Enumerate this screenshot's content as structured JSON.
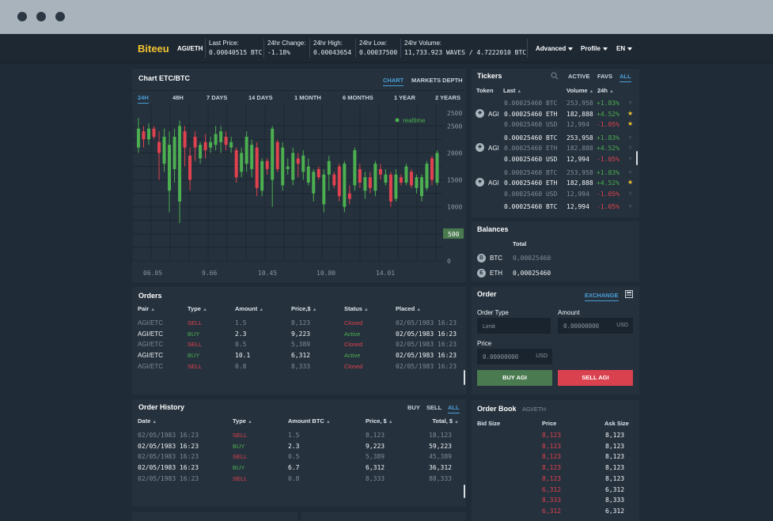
{
  "header": {
    "brand": "Biteeu",
    "pair": "AGI/ETH",
    "stats": [
      {
        "label": "Last Price:",
        "value": "0.00040515 BTC"
      },
      {
        "label": "24hr Change:",
        "value": "-1.18%"
      },
      {
        "label": "24hr High:",
        "value": "0.00043654"
      },
      {
        "label": "24hr Low:",
        "value": "0.00037500"
      },
      {
        "label": "24hr Volume:",
        "value": "11,733.923 WAVES / 4.7222010 BTC"
      }
    ],
    "menus": [
      "Advanced",
      "Profile",
      "EN"
    ]
  },
  "chart_panel": {
    "title": "Chart ETC/BTC",
    "view_tabs": [
      "CHART",
      "MARKETS DEPTH"
    ],
    "active_view": "CHART",
    "range_tabs": [
      "24H",
      "48H",
      "7 DAYS",
      "14 DAYS",
      "1 MONTH",
      "6 MONTHS",
      "1 YEAR",
      "2 YEARS"
    ],
    "active_range": "24H",
    "realtime_label": "realtime",
    "current_marker": "500"
  },
  "chart_data": {
    "type": "candlestick",
    "x_ticks": [
      "06.05",
      "9.66",
      "10.45",
      "10.80",
      "14.01"
    ],
    "y_ticks": [
      0,
      500,
      1000,
      1500,
      2000,
      2500,
      2500
    ],
    "ylim": [
      0,
      2900
    ],
    "candles": [
      {
        "o": 2100,
        "c": 2450,
        "h": 2650,
        "l": 2000
      },
      {
        "o": 2400,
        "c": 2250,
        "h": 2500,
        "l": 2100
      },
      {
        "o": 2250,
        "c": 2450,
        "h": 2550,
        "l": 2150
      },
      {
        "o": 2450,
        "c": 2300,
        "h": 2500,
        "l": 2250
      },
      {
        "o": 2200,
        "c": 2000,
        "h": 2400,
        "l": 1500
      },
      {
        "o": 1800,
        "c": 2300,
        "h": 2450,
        "l": 1650
      },
      {
        "o": 1300,
        "c": 2150,
        "h": 2400,
        "l": 900
      },
      {
        "o": 1700,
        "c": 2300,
        "h": 2450,
        "l": 1450
      },
      {
        "o": 1100,
        "c": 2500,
        "h": 2600,
        "l": 700
      },
      {
        "o": 2400,
        "c": 2100,
        "h": 2500,
        "l": 1750
      },
      {
        "o": 1950,
        "c": 1500,
        "h": 2100,
        "l": 1300
      },
      {
        "o": 2300,
        "c": 2100,
        "h": 2400,
        "l": 1850
      },
      {
        "o": 1900,
        "c": 2150,
        "h": 2200,
        "l": 1800
      },
      {
        "o": 2200,
        "c": 2050,
        "h": 2350,
        "l": 1900
      },
      {
        "o": 2100,
        "c": 2200,
        "h": 2300,
        "l": 2000
      },
      {
        "o": 2150,
        "c": 2350,
        "h": 2500,
        "l": 2050
      },
      {
        "o": 2200,
        "c": 2400,
        "h": 2500,
        "l": 2000
      },
      {
        "o": 2300,
        "c": 2150,
        "h": 2400,
        "l": 2050
      },
      {
        "o": 2100,
        "c": 2200,
        "h": 2300,
        "l": 2000
      },
      {
        "o": 2050,
        "c": 1550,
        "h": 2100,
        "l": 1450
      },
      {
        "o": 1650,
        "c": 2000,
        "h": 2100,
        "l": 1550
      },
      {
        "o": 1800,
        "c": 2300,
        "h": 2400,
        "l": 1650
      },
      {
        "o": 1700,
        "c": 2150,
        "h": 2250,
        "l": 1550
      },
      {
        "o": 2100,
        "c": 1350,
        "h": 2200,
        "l": 1200
      },
      {
        "o": 1300,
        "c": 1850,
        "h": 1900,
        "l": 1200
      },
      {
        "o": 1850,
        "c": 1700,
        "h": 1900,
        "l": 1600
      },
      {
        "o": 1500,
        "c": 2450,
        "h": 2500,
        "l": 1000
      },
      {
        "o": 2200,
        "c": 1700,
        "h": 2250,
        "l": 1650
      },
      {
        "o": 1400,
        "c": 2100,
        "h": 2200,
        "l": 1300
      },
      {
        "o": 1700,
        "c": 1750,
        "h": 1900,
        "l": 1600
      },
      {
        "o": 1500,
        "c": 2000,
        "h": 2100,
        "l": 1400
      },
      {
        "o": 1900,
        "c": 1800,
        "h": 2000,
        "l": 1550
      },
      {
        "o": 1650,
        "c": 1950,
        "h": 2050,
        "l": 1500
      },
      {
        "o": 1450,
        "c": 1750,
        "h": 1900,
        "l": 1400
      },
      {
        "o": 1250,
        "c": 1650,
        "h": 1700,
        "l": 1100
      },
      {
        "o": 1700,
        "c": 1550,
        "h": 1750,
        "l": 1500
      },
      {
        "o": 1050,
        "c": 1600,
        "h": 1700,
        "l": 900
      },
      {
        "o": 1600,
        "c": 1850,
        "h": 1950,
        "l": 1300
      },
      {
        "o": 1600,
        "c": 1400,
        "h": 1650,
        "l": 1350
      },
      {
        "o": 1750,
        "c": 1200,
        "h": 1800,
        "l": 1100
      },
      {
        "o": 1000,
        "c": 1800,
        "h": 1850,
        "l": 900
      },
      {
        "o": 1250,
        "c": 1150,
        "h": 1400,
        "l": 1050
      },
      {
        "o": 1400,
        "c": 2050,
        "h": 2100,
        "l": 1300
      },
      {
        "o": 1700,
        "c": 1450,
        "h": 1800,
        "l": 1350
      },
      {
        "o": 1300,
        "c": 1550,
        "h": 1650,
        "l": 1150
      },
      {
        "o": 1550,
        "c": 1350,
        "h": 1650,
        "l": 1250
      },
      {
        "o": 1300,
        "c": 1800,
        "h": 1850,
        "l": 1200
      },
      {
        "o": 1700,
        "c": 1600,
        "h": 1800,
        "l": 1500
      },
      {
        "o": 1450,
        "c": 1600,
        "h": 1700,
        "l": 1400
      },
      {
        "o": 1600,
        "c": 1100,
        "h": 1650,
        "l": 1000
      },
      {
        "o": 1150,
        "c": 1600,
        "h": 1700,
        "l": 1100
      },
      {
        "o": 1550,
        "c": 1450,
        "h": 1600,
        "l": 1400
      },
      {
        "o": 1450,
        "c": 1750,
        "h": 1800,
        "l": 1400
      },
      {
        "o": 1650,
        "c": 1400,
        "h": 1700,
        "l": 1350
      },
      {
        "o": 1350,
        "c": 1550,
        "h": 1600,
        "l": 1250
      },
      {
        "o": 1200,
        "c": 1550,
        "h": 1600,
        "l": 1100
      },
      {
        "o": 1350,
        "c": 1800,
        "h": 1850,
        "l": 1300
      },
      {
        "o": 1900,
        "c": 1500,
        "h": 1950,
        "l": 1400
      },
      {
        "o": 1450,
        "c": 2000,
        "h": 2050,
        "l": 1400
      }
    ],
    "up_color": "#4caf50",
    "down_color": "#e0424e"
  },
  "orders": {
    "title": "Orders",
    "columns": [
      "Pair",
      "Type",
      "Amount",
      "Price,$",
      "Status",
      "Placed"
    ],
    "rows": [
      {
        "pair": "AGI/ETC",
        "type": "SELL",
        "amount": "1.5",
        "price": "8,123",
        "status": "Closed",
        "placed": "02/05/1983 16:23"
      },
      {
        "pair": "AGI/ETC",
        "type": "BUY",
        "amount": "2.3",
        "price": "9,223",
        "status": "Active",
        "placed": "02/05/1983 16:23"
      },
      {
        "pair": "AGI/ETC",
        "type": "SELL",
        "amount": "0.5",
        "price": "5,389",
        "status": "Closed",
        "placed": "02/05/1983 16:23"
      },
      {
        "pair": "AGI/ETC",
        "type": "BUY",
        "amount": "10.1",
        "price": "6,312",
        "status": "Active",
        "placed": "02/05/1983 16:23"
      },
      {
        "pair": "AGI/ETC",
        "type": "SELL",
        "amount": "0.8",
        "price": "8,333",
        "status": "Closed",
        "placed": "02/05/1983 16:23"
      }
    ]
  },
  "order_history": {
    "title": "Order History",
    "filters": [
      "BUY",
      "SELL",
      "ALL"
    ],
    "active_filter": "ALL",
    "columns": [
      "Date",
      "Type",
      "Amount BTC",
      "Price, $",
      "Total, $"
    ],
    "rows": [
      {
        "date": "02/05/1983 16:23",
        "type": "SELL",
        "amount": "1.5",
        "price": "8,123",
        "total": "18,123"
      },
      {
        "date": "02/05/1983 16:23",
        "type": "BUY",
        "amount": "2.3",
        "price": "9,223",
        "total": "59,223"
      },
      {
        "date": "02/05/1983 16:23",
        "type": "SELL",
        "amount": "0.5",
        "price": "5,389",
        "total": "45,389"
      },
      {
        "date": "02/05/1983 16:23",
        "type": "BUY",
        "amount": "6.7",
        "price": "6,312",
        "total": "36,312"
      },
      {
        "date": "02/05/1983 16:23",
        "type": "SELL",
        "amount": "0.8",
        "price": "8,333",
        "total": "88,333"
      }
    ]
  },
  "tickers": {
    "title": "Tickers",
    "tabs": [
      "ACTIVE",
      "FAVS",
      "ALL"
    ],
    "active_tab": "ALL",
    "columns": [
      "Token",
      "Last",
      "Volume",
      "24h"
    ],
    "rows": [
      {
        "token": "",
        "last": "0.00025460 BTC",
        "volume": "253,958",
        "change": "+1.83%",
        "dir": "up",
        "bright": false,
        "star": false
      },
      {
        "token": "AGI",
        "last": "0.00025460 ETH",
        "volume": "182,888",
        "change": "+4.52%",
        "dir": "up",
        "bright": true,
        "star": true
      },
      {
        "token": "",
        "last": "0.00025460 USD",
        "volume": "12,994",
        "change": "-1.05%",
        "dir": "down",
        "bright": false,
        "star": true
      },
      {
        "token": "",
        "last": "0.00025460 BTC",
        "volume": "253,958",
        "change": "+1.83%",
        "dir": "up",
        "bright": true,
        "star": false
      },
      {
        "token": "AGI",
        "last": "0.00025460 ETH",
        "volume": "182,888",
        "change": "+4.52%",
        "dir": "up",
        "bright": false,
        "star": false
      },
      {
        "token": "",
        "last": "0.00025460 USD",
        "volume": "12,994",
        "change": "-1.05%",
        "dir": "down",
        "bright": true,
        "star": false
      },
      {
        "token": "",
        "last": "0.00025460 BTC",
        "volume": "253,958",
        "change": "+1.83%",
        "dir": "up",
        "bright": false,
        "star": false
      },
      {
        "token": "AGI",
        "last": "0.00025460 ETH",
        "volume": "182,888",
        "change": "+4.52%",
        "dir": "up",
        "bright": true,
        "star": true
      },
      {
        "token": "",
        "last": "0.00025460 USD",
        "volume": "12,994",
        "change": "-1.05%",
        "dir": "down",
        "bright": false,
        "star": false
      },
      {
        "token": "",
        "last": "0.00025460 BTC",
        "volume": "12,994",
        "change": "-1.05%",
        "dir": "down",
        "bright": true,
        "star": false
      }
    ]
  },
  "balances": {
    "title": "Balances",
    "column": "Total",
    "rows": [
      {
        "coin": "BTC",
        "total": "0,00025460",
        "bright": false
      },
      {
        "coin": "ETH",
        "total": "0,00025460",
        "bright": true
      }
    ]
  },
  "order_form": {
    "title": "Order",
    "tab": "EXCHANGE",
    "order_type_label": "Order Type",
    "order_type_value": "Limit",
    "amount_label": "Amount",
    "amount_value": "0.00000000",
    "amount_unit": "USD",
    "price_label": "Price",
    "price_value": "0.00000000",
    "price_unit": "USD",
    "buy_label": "BUY AGI",
    "sell_label": "SELL AGI"
  },
  "order_book": {
    "title": "Order Book",
    "pair": "AGI/ETH",
    "columns": [
      "Bid Size",
      "Price",
      "Ask Size"
    ],
    "rows": [
      {
        "price": "8,123",
        "ask": "8,123"
      },
      {
        "price": "8,123",
        "ask": "8,123"
      },
      {
        "price": "8,123",
        "ask": "8,123"
      },
      {
        "price": "8,123",
        "ask": "8,123"
      },
      {
        "price": "8,123",
        "ask": "8,123"
      },
      {
        "price": "6,312",
        "ask": "6,312"
      },
      {
        "price": "8,333",
        "ask": "8,333"
      },
      {
        "price": "6,312",
        "ask": "6,312"
      }
    ]
  },
  "colors": {
    "accent": "#4a9fd8",
    "brand": "#f4c430",
    "buy": "#4a7a4f",
    "sell": "#d9414f"
  }
}
